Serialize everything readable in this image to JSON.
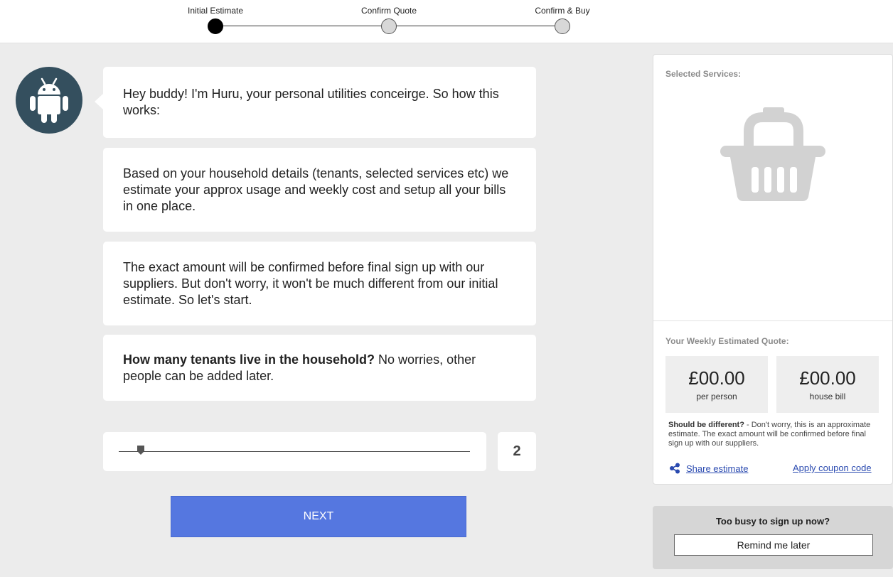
{
  "stepper": {
    "steps": [
      {
        "label": "Initial Estimate",
        "active": true
      },
      {
        "label": "Confirm Quote",
        "active": false
      },
      {
        "label": "Confirm & Buy",
        "active": false
      }
    ]
  },
  "assistant": {
    "avatar_icon": "android-icon"
  },
  "messages": [
    {
      "text": "Hey buddy! I'm Huru, your personal utilities conceirge. So how this works:"
    },
    {
      "text": "Based on your household details (tenants, selected services etc) we estimate your approx usage and weekly cost and setup all your bills in one place."
    },
    {
      "text": "The exact amount will be confirmed before final sign up with our suppliers. But don't worry, it won't be much different from our initial estimate. So let's start."
    },
    {
      "bold": "How many tenants live in the household?",
      "text": " No worries, other people can be added later."
    }
  ],
  "tenants": {
    "value": "2"
  },
  "next_button": "NEXT",
  "sidebar": {
    "selected_services_title": "Selected Services:",
    "basket_icon": "basket-icon",
    "quote_title": "Your Weekly Estimated Quote:",
    "per_person_amount": "£00.00",
    "per_person_label": "per person",
    "house_bill_amount": "£00.00",
    "house_bill_label": "house bill",
    "note_bold": "Should be different?",
    "note_text": " - Don't worry, this is an approximate estimate. The exact amount will be confirmed before final sign up with our suppliers.",
    "share_icon": "share-icon",
    "share_label": "Share estimate",
    "coupon_label": "Apply coupon code"
  },
  "busy": {
    "title": "Too busy to sign up now?",
    "button": "Remind me later"
  },
  "colors": {
    "primary_button": "#5577e0",
    "avatar_bg": "#344f5e",
    "link": "#2a4ab0"
  }
}
